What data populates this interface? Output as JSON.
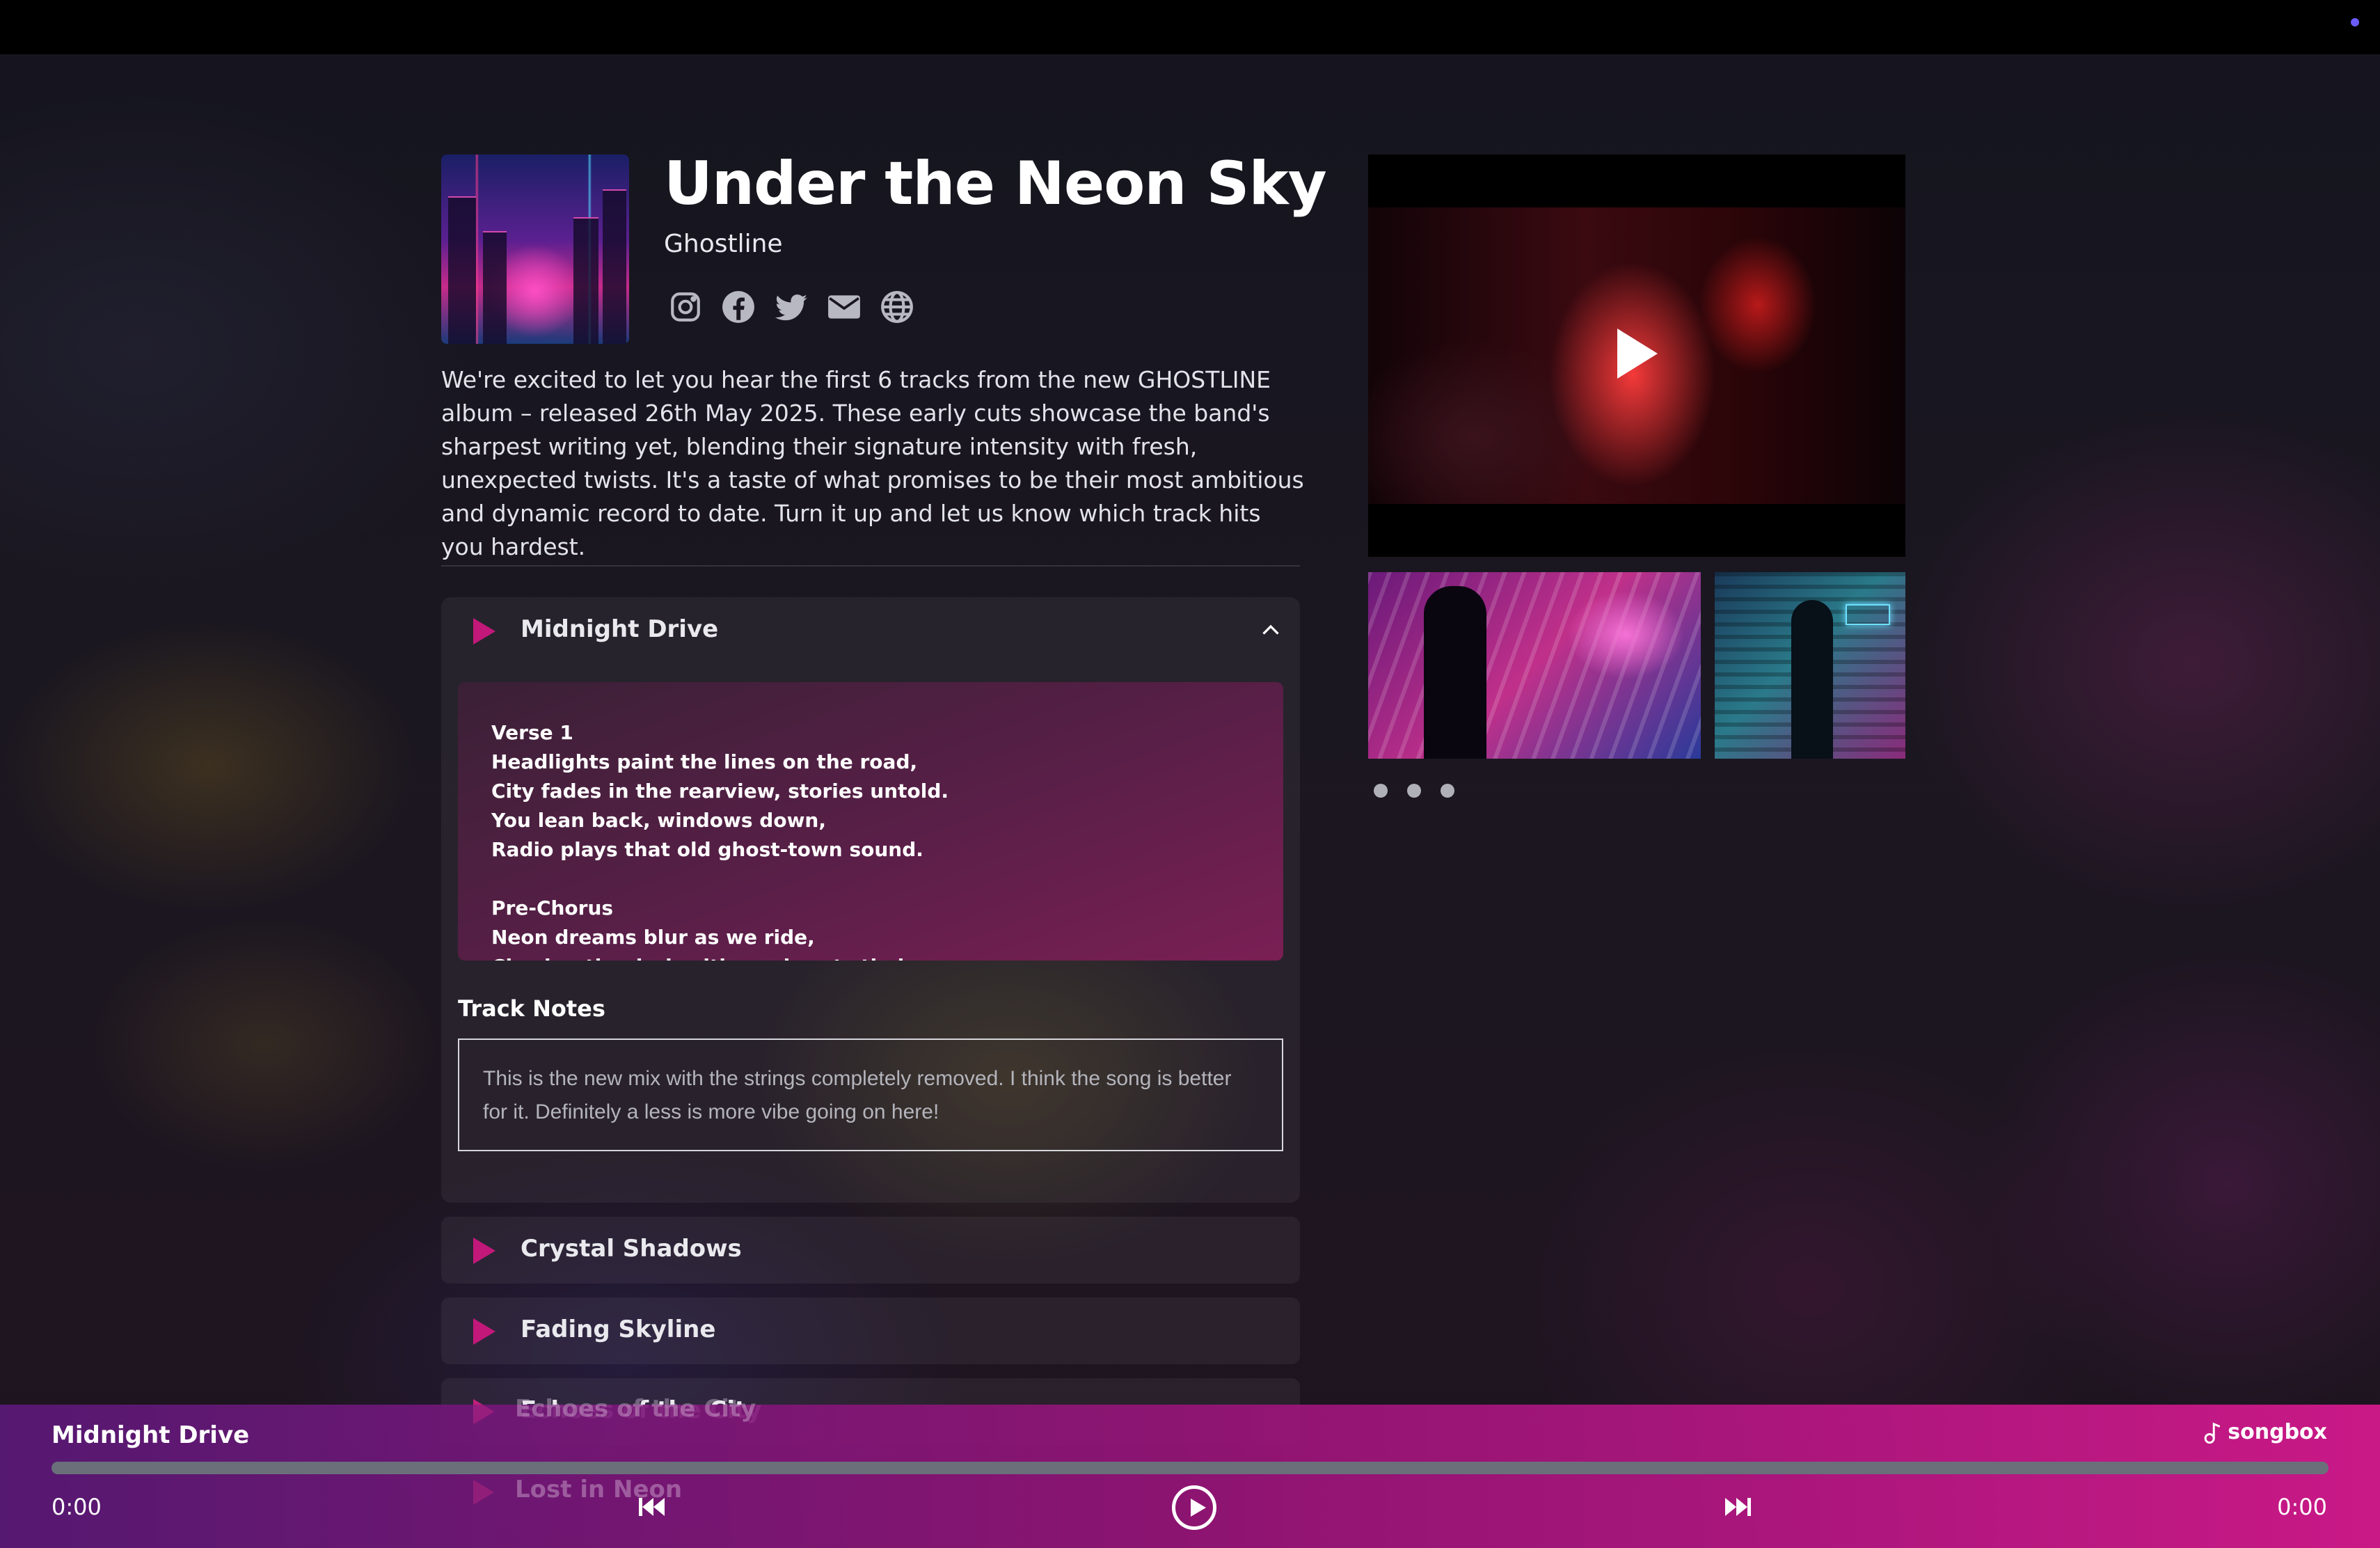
{
  "album": {
    "title": "Under the Neon Sky",
    "artist": "Ghostline",
    "description": "We're excited to let you hear the first 6 tracks from the new GHOSTLINE album – released 26th May 2025. These early cuts showcase the band's sharpest writing yet, blending their signature intensity with fresh, unexpected twists. It's a taste of what promises to be their most ambitious and dynamic record to date. Turn it up and let us know which track hits you hardest.",
    "socials": [
      "instagram-icon",
      "facebook-icon",
      "twitter-icon",
      "email-icon",
      "globe-icon"
    ]
  },
  "tracks": [
    {
      "name": "Midnight Drive",
      "expanded": true,
      "lyrics": "Verse 1\nHeadlights paint the lines on the road,\nCity fades in the rearview, stories untold.\nYou lean back, windows down,\nRadio plays that old ghost-town sound.\n\nPre-Chorus\nNeon dreams blur as we ride,\nChasing the dark with our hearts tied",
      "notes_label": "Track Notes",
      "notes": "This is the new mix with the strings completely removed. I think the song is better for it. Definitely a less is more vibe going on here!"
    },
    {
      "name": "Crystal Shadows"
    },
    {
      "name": "Fading Skyline"
    },
    {
      "name": "Echoes of the City"
    },
    {
      "name": "Lost in Neon"
    }
  ],
  "gallery": {
    "dots": 3
  },
  "player": {
    "now_playing": "Midnight Drive",
    "brand": "songbox",
    "time_current": "0:00",
    "time_total": "0:00",
    "progress": 0
  },
  "colors": {
    "accent": "#c2187a",
    "player_start": "#5a1978",
    "player_end": "#d2198c"
  }
}
